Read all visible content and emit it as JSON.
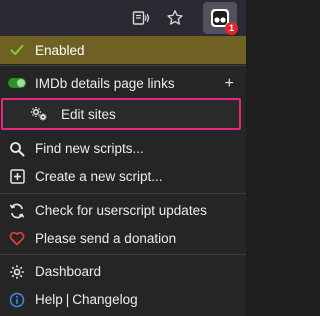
{
  "toolbar": {
    "reader_icon": "reader-view-icon",
    "star_icon": "bookmark-star-icon",
    "extension_icon": "tampermonkey-icon",
    "badge_count": "1"
  },
  "menu": {
    "enabled_label": "Enabled",
    "script": {
      "name": "IMDb details page links",
      "enabled": true,
      "add_symbol": "+"
    },
    "edit_sites_label": "Edit sites",
    "find_scripts_label": "Find new scripts...",
    "create_script_label": "Create a new script...",
    "check_updates_label": "Check for userscript updates",
    "donate_label": "Please send a donation",
    "dashboard_label": "Dashboard",
    "help_label": "Help",
    "separator": "|",
    "changelog_label": "Changelog"
  },
  "colors": {
    "enabled_bg": "#6f6024",
    "check_green": "#7ac943",
    "toggle_green": "#2f8f2f",
    "heart_red": "#e03c3c",
    "highlight_border": "#e0297a",
    "badge_red": "#e0262c",
    "info_blue": "#3a8ee6"
  }
}
